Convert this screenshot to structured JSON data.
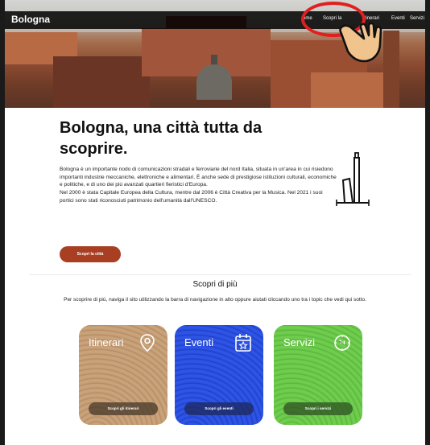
{
  "navbar": {
    "brand": "Bologna",
    "items": [
      "ome",
      "Scopri la",
      "Itinerari",
      "Eventi",
      "Servizi"
    ]
  },
  "hero": {
    "title": "Bologna, una città tutta da scoprire.",
    "paragraph_1": "Bologna è un importante nodo di comunicazioni stradali e ferroviarie del nord Italia, situata in un'area in cui risiedono importanti industrie meccaniche, elettroniche e alimentari. È anche sede di prestigiose istituzioni culturali, economiche e politiche, e di uno dei più avanzati quartieri fieristici d'Europa.",
    "paragraph_2": "Nel 2000 è stata Capitale Europea della Cultura, mentre dal 2006 è Città Creativa per la Musica. Nel 2021 i suoi portici sono stati riconosciuti patrimonio dell'umanità dall'UNESCO.",
    "cta_label": "Scopri la città"
  },
  "discover": {
    "title": "Scopri di più",
    "subtitle": "Per scoprire di più, naviga il sito utilizzando la barra di navigazione in alto oppure aiutati cliccando uno tra i topic che vedi qui sotto."
  },
  "cards": [
    {
      "title": "Itinerari",
      "button": "Scopri gli itinerari",
      "icon": "map-pin-icon"
    },
    {
      "title": "Eventi",
      "button": "Scopri gli eventi",
      "icon": "calendar-star-icon"
    },
    {
      "title": "Servizi",
      "button": "Scopri i servizi",
      "icon": "clock-24-icon"
    }
  ],
  "colors": {
    "cta": "#a83e22",
    "card_itinerari": "#c9a27a",
    "card_eventi": "#2e54e6",
    "card_servizi": "#6fcc4e",
    "annotation": "#e02020"
  }
}
